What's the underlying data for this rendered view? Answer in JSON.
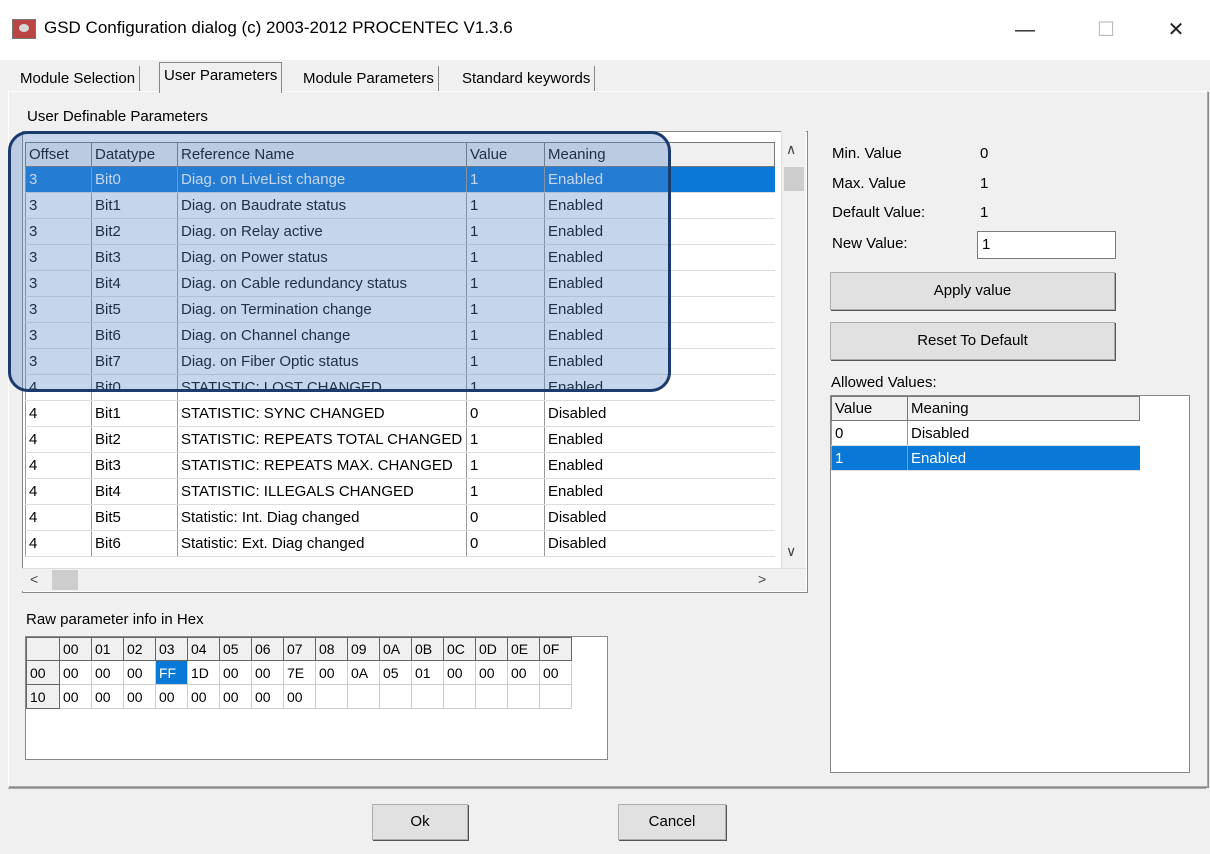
{
  "window": {
    "title": "GSD Configuration dialog (c) 2003-2012 PROCENTEC V1.3.6",
    "minimize": "—",
    "maximize": "☐",
    "close": "✕"
  },
  "tabs": [
    "Module Selection",
    "User Parameters",
    "Module Parameters",
    "Standard keywords"
  ],
  "active_tab": "User Parameters",
  "params": {
    "group_label": "User Definable Parameters",
    "columns": [
      "Offset",
      "Datatype",
      "Reference Name",
      "Value",
      "Meaning"
    ],
    "rows": [
      [
        "3",
        "Bit0",
        "Diag. on LiveList change",
        "1",
        "Enabled"
      ],
      [
        "3",
        "Bit1",
        "Diag. on Baudrate status",
        "1",
        "Enabled"
      ],
      [
        "3",
        "Bit2",
        "Diag. on Relay active",
        "1",
        "Enabled"
      ],
      [
        "3",
        "Bit3",
        "Diag. on Power status",
        "1",
        "Enabled"
      ],
      [
        "3",
        "Bit4",
        "Diag. on Cable redundancy status",
        "1",
        "Enabled"
      ],
      [
        "3",
        "Bit5",
        "Diag. on Termination change",
        "1",
        "Enabled"
      ],
      [
        "3",
        "Bit6",
        "Diag. on Channel change",
        "1",
        "Enabled"
      ],
      [
        "3",
        "Bit7",
        "Diag. on Fiber Optic status",
        "1",
        "Enabled"
      ],
      [
        "4",
        "Bit0",
        "STATISTIC: LOST CHANGED",
        "1",
        "Enabled"
      ],
      [
        "4",
        "Bit1",
        "STATISTIC: SYNC CHANGED",
        "0",
        "Disabled"
      ],
      [
        "4",
        "Bit2",
        "STATISTIC: REPEATS TOTAL CHANGED",
        "1",
        "Enabled"
      ],
      [
        "4",
        "Bit3",
        "STATISTIC: REPEATS MAX. CHANGED",
        "1",
        "Enabled"
      ],
      [
        "4",
        "Bit4",
        "STATISTIC: ILLEGALS CHANGED",
        "1",
        "Enabled"
      ],
      [
        "4",
        "Bit5",
        "Statistic: Int. Diag changed",
        "0",
        "Disabled"
      ],
      [
        "4",
        "Bit6",
        "Statistic: Ext. Diag changed",
        "0",
        "Disabled"
      ]
    ],
    "selected_row": 0
  },
  "details": {
    "min_label": "Min. Value",
    "min_value": "0",
    "max_label": "Max. Value",
    "max_value": "1",
    "default_label": "Default Value:",
    "default_value": "1",
    "new_label": "New Value:",
    "new_value": "1",
    "apply_button": "Apply value",
    "reset_button": "Reset To Default",
    "allowed_label": "Allowed Values:",
    "allowed_columns": [
      "Value",
      "Meaning"
    ],
    "allowed_rows": [
      [
        "0",
        "Disabled"
      ],
      [
        "1",
        "Enabled"
      ]
    ],
    "allowed_selected": 1
  },
  "hex": {
    "label": "Raw parameter info in Hex",
    "columns": [
      "00",
      "01",
      "02",
      "03",
      "04",
      "05",
      "06",
      "07",
      "08",
      "09",
      "0A",
      "0B",
      "0C",
      "0D",
      "0E",
      "0F"
    ],
    "rows": [
      {
        "addr": "00",
        "bytes": [
          "00",
          "00",
          "00",
          "FF",
          "1D",
          "00",
          "00",
          "7E",
          "00",
          "0A",
          "05",
          "01",
          "00",
          "00",
          "00",
          "00"
        ]
      },
      {
        "addr": "10",
        "bytes": [
          "00",
          "00",
          "00",
          "00",
          "00",
          "00",
          "00",
          "00"
        ]
      }
    ],
    "highlight": {
      "row": 0,
      "col": 3
    }
  },
  "footer": {
    "ok_button": "Ok",
    "cancel_button": "Cancel"
  },
  "colors": {
    "selection": "#0a78d7",
    "overlay_border": "#1b3a6e",
    "overlay_fill": "rgba(85,135,200,0.35)"
  }
}
